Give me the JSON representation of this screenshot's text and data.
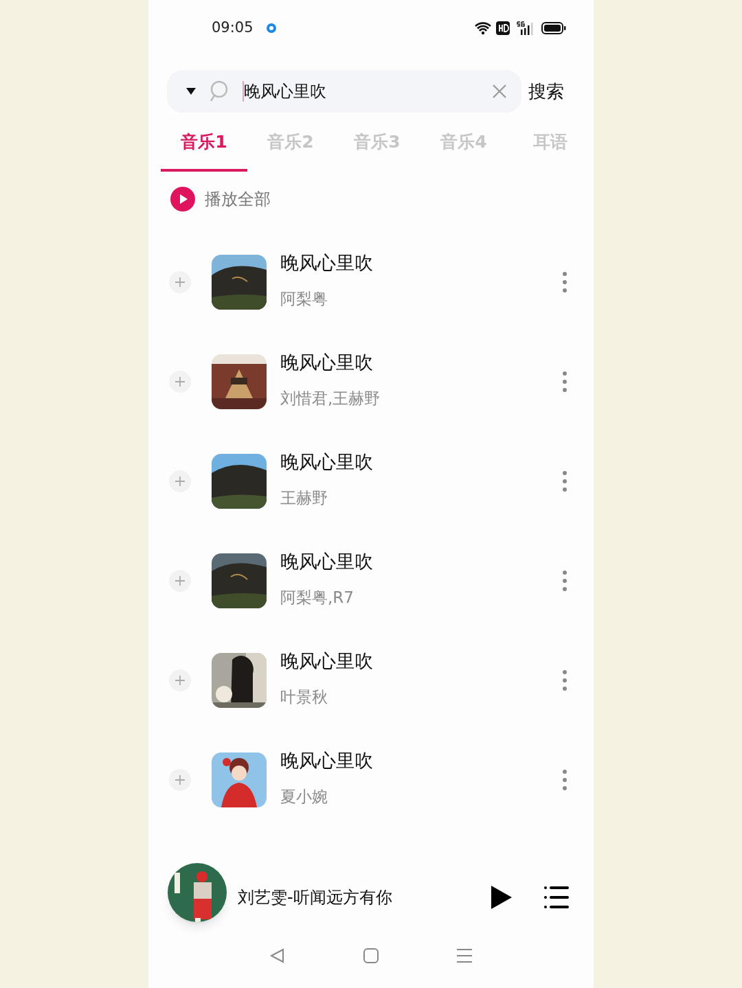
{
  "status_bar": {
    "time": "09:05"
  },
  "search": {
    "value": "晚风心里吹",
    "button": "搜索"
  },
  "tabs": [
    {
      "label": "音乐1",
      "selected": true
    },
    {
      "label": "音乐2",
      "selected": false
    },
    {
      "label": "音乐3",
      "selected": false
    },
    {
      "label": "音乐4",
      "selected": false
    },
    {
      "label": "耳语",
      "selected": false
    }
  ],
  "play_all": "播放全部",
  "songs": [
    {
      "title": "晚风心里吹",
      "artist": "阿梨粤"
    },
    {
      "title": "晚风心里吹",
      "artist": "刘惜君,王赫野"
    },
    {
      "title": "晚风心里吹",
      "artist": "王赫野"
    },
    {
      "title": "晚风心里吹",
      "artist": "阿梨粤,R7"
    },
    {
      "title": "晚风心里吹",
      "artist": "叶景秋"
    },
    {
      "title": "晚风心里吹",
      "artist": "夏小婉"
    }
  ],
  "now_playing": {
    "title": "刘艺雯-听闻远方有你"
  }
}
